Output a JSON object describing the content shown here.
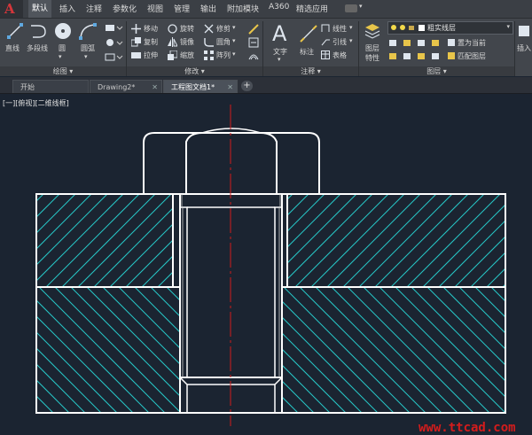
{
  "app": {
    "logo": "A"
  },
  "menu": {
    "items": [
      {
        "label": "默认"
      },
      {
        "label": "插入"
      },
      {
        "label": "注释"
      },
      {
        "label": "参数化"
      },
      {
        "label": "视图"
      },
      {
        "label": "管理"
      },
      {
        "label": "输出"
      },
      {
        "label": "附加模块"
      },
      {
        "label": "A360"
      },
      {
        "label": "精选应用"
      }
    ]
  },
  "ribbon": {
    "draw": {
      "title": "绘图",
      "line": "直线",
      "polyline": "多段线",
      "circle": "圆",
      "arc": "圆弧"
    },
    "modify": {
      "title": "修改",
      "move": "移动",
      "rotate": "旋转",
      "trim": "修剪",
      "copy": "复制",
      "mirror": "镜像",
      "fillet": "圆角",
      "stretch": "拉伸",
      "scale": "缩放",
      "array": "阵列"
    },
    "annotation": {
      "title": "注释",
      "text": "文字",
      "dimension": "标注",
      "linear": "线性",
      "leader": "引线",
      "table": "表格"
    },
    "layers": {
      "title": "图层",
      "properties_line1": "图层",
      "properties_line2": "特性",
      "current_layer": "粗实线层",
      "make_current": "置为当前",
      "match_layer": "匹配图层"
    },
    "insert": {
      "label": "插入"
    }
  },
  "tabs": [
    {
      "label": "开始"
    },
    {
      "label": "Drawing2*"
    },
    {
      "label": "工程图文档1*"
    }
  ],
  "viewport": {
    "label": "[一][俯视][二维线框]"
  },
  "colors": {
    "background": "#1b2431",
    "outline": "#ffffff",
    "hatch": "#27c8c8",
    "centerline": "#d11c1c"
  },
  "watermark": "www.ttcad.com"
}
